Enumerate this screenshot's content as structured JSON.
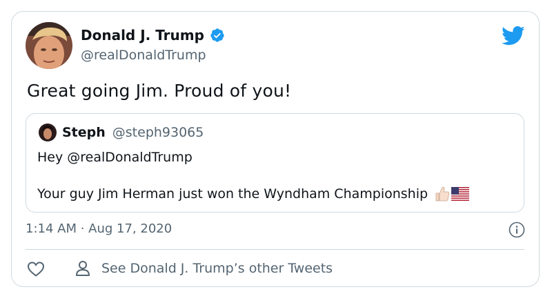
{
  "tweet": {
    "author": {
      "display_name": "Donald J. Trump",
      "handle": "@realDonaldTrump",
      "verified": true,
      "avatar_icon": "user-avatar-photo"
    },
    "text": "Great going Jim. Proud of you!",
    "timestamp": "1:14 AM · Aug 17, 2020",
    "brand_icon": "twitter-bird-icon",
    "colors": {
      "brand": "#1d9bf0",
      "text": "#0f1419",
      "secondary": "#536471",
      "border": "#cfd9de"
    }
  },
  "quoted": {
    "author": {
      "display_name": "Steph",
      "handle": "@steph93065",
      "avatar_icon": "user-avatar-photo"
    },
    "line1": "Hey @realDonaldTrump",
    "line2": "Your guy Jim Herman just won the Wyndham Championship",
    "emojis": [
      "thumbs-up-emoji",
      "us-flag-emoji"
    ]
  },
  "footer": {
    "like_icon": "heart-icon",
    "other_tweets_label": "See Donald J. Trump’s other Tweets",
    "other_icon": "person-icon",
    "info_icon": "info-icon"
  }
}
